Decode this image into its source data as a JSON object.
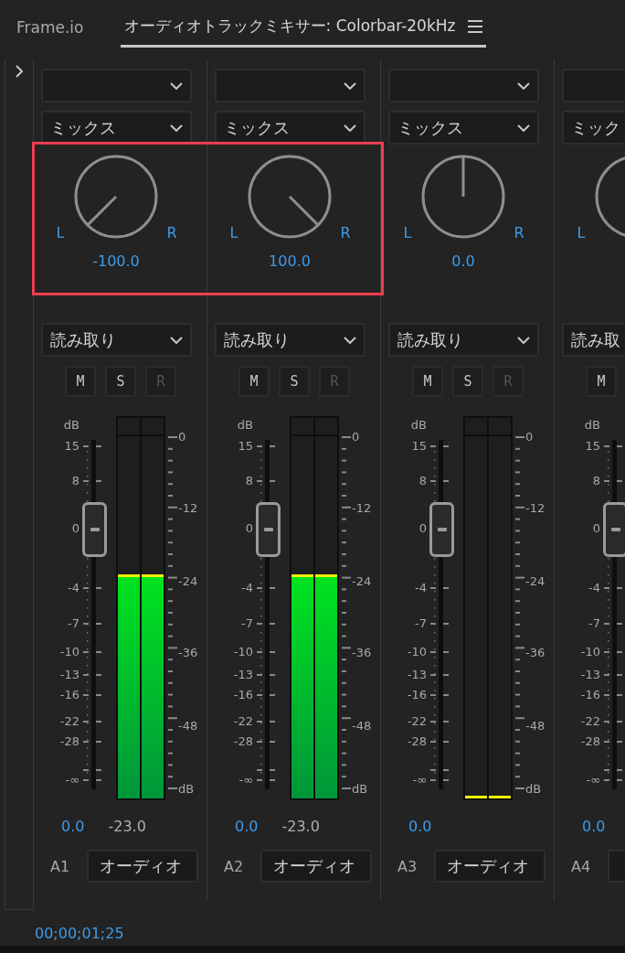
{
  "header": {
    "panel_name": "Frame.io",
    "tabs": [
      {
        "label": "オーディオトラックミキサー: Colorbar-20kHz",
        "selected": true
      }
    ]
  },
  "strips": [
    {
      "mix": "ミックス",
      "pan": {
        "left": "L",
        "right": "R",
        "value": "-100.0",
        "highlighted": true
      },
      "automation": "読み取り",
      "buttons": [
        {
          "label": "M",
          "disabled": false
        },
        {
          "label": "S",
          "disabled": false
        },
        {
          "label": "R",
          "disabled": true
        }
      ],
      "fader": {
        "level": 0.746,
        "value": "0.0",
        "scale": [
          "dB",
          "15",
          "8",
          "0",
          "-4",
          "-7",
          "-10",
          "-13",
          "-16",
          "-22",
          "-28",
          "-∞"
        ]
      },
      "meter": {
        "channels": [
          {
            "level": 0.61
          },
          {
            "level": 0.61
          }
        ],
        "scale": [
          "0",
          "-12",
          "-24",
          "-36",
          "-48",
          "dB"
        ],
        "reading": "-23.0"
      },
      "track": {
        "id": "A1",
        "name": "オーディオ"
      }
    },
    {
      "mix": "ミックス",
      "pan": {
        "left": "L",
        "right": "R",
        "value": "100.0",
        "highlighted": true
      },
      "automation": "読み取り",
      "buttons": [
        {
          "label": "M",
          "disabled": false
        },
        {
          "label": "S",
          "disabled": false
        },
        {
          "label": "R",
          "disabled": true
        }
      ],
      "fader": {
        "level": 0.746,
        "value": "0.0",
        "scale": [
          "dB",
          "15",
          "8",
          "0",
          "-4",
          "-7",
          "-10",
          "-13",
          "-16",
          "-22",
          "-28",
          "-∞"
        ]
      },
      "meter": {
        "channels": [
          {
            "level": 0.61
          },
          {
            "level": 0.61
          }
        ],
        "scale": [
          "0",
          "-12",
          "-24",
          "-36",
          "-48",
          "dB"
        ],
        "reading": "-23.0"
      },
      "track": {
        "id": "A2",
        "name": "オーディオ"
      }
    },
    {
      "mix": "ミックス",
      "pan": {
        "left": "L",
        "right": "R",
        "value": "0.0",
        "highlighted": false
      },
      "automation": "読み取り",
      "buttons": [
        {
          "label": "M",
          "disabled": false
        },
        {
          "label": "S",
          "disabled": false
        },
        {
          "label": "R",
          "disabled": true
        }
      ],
      "fader": {
        "level": 0.746,
        "value": "0.0",
        "scale": [
          "dB",
          "15",
          "8",
          "0",
          "-4",
          "-7",
          "-10",
          "-13",
          "-16",
          "-22",
          "-28",
          "-∞"
        ]
      },
      "meter": {
        "channels": [
          {
            "level": 0
          },
          {
            "level": 0
          }
        ],
        "scale": [
          "0",
          "-12",
          "-24",
          "-36",
          "-48",
          "dB"
        ]
      },
      "track": {
        "id": "A3",
        "name": "オーディオ"
      }
    },
    {
      "mix": "ミック",
      "pan": {
        "left": "L",
        "highlighted": false
      },
      "automation": "読み取",
      "buttons": [
        {
          "label": "M",
          "disabled": false
        }
      ],
      "fader": {
        "level": 0.746,
        "value": "0.0",
        "scale": [
          "dB",
          "15",
          "8",
          "0",
          "-4",
          "-7",
          "-10",
          "-13",
          "-16",
          "-22",
          "-28",
          "-∞"
        ]
      },
      "track": {
        "id": "A4"
      }
    }
  ],
  "timecode": "00;00;01;25"
}
